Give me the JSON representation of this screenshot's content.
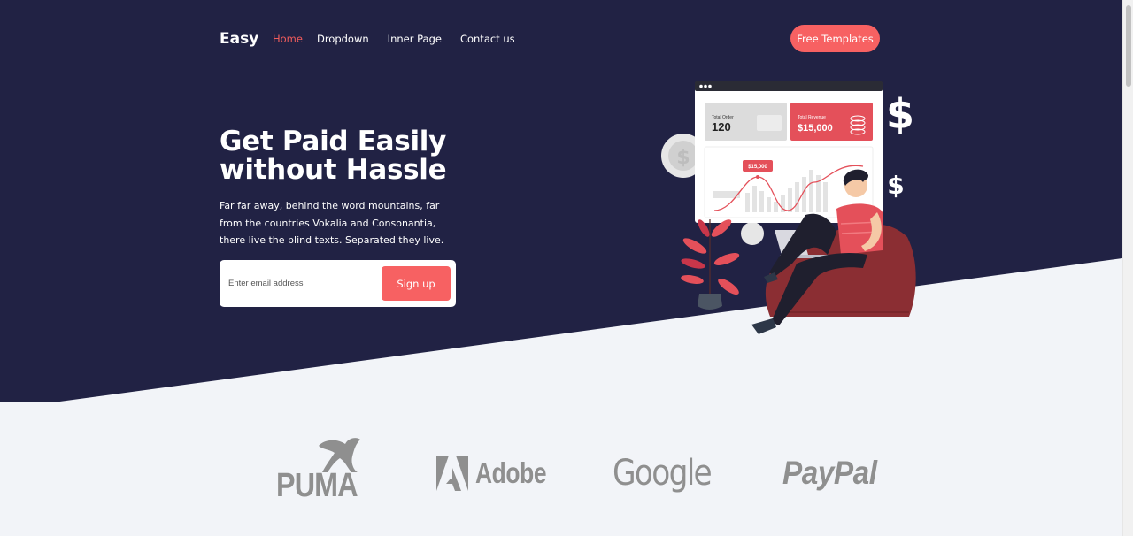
{
  "nav": {
    "logo": "Easy",
    "links": [
      "Home",
      "Dropdown",
      "Inner Page",
      "Contact us"
    ],
    "cta_label": "Free Templates"
  },
  "hero": {
    "headline_line1": "Get Paid Easily",
    "headline_line2": "without Hassle",
    "subtext": "Far far away, behind the word mountains, far from the countries Vokalia and Consonantia, there live the blind texts. Separated they live.",
    "email_placeholder": "Enter email address",
    "signup_label": "Sign up"
  },
  "illustration": {
    "total_order_label": "Total Order",
    "total_order_value": "120",
    "total_revenue_label": "Total Revenue",
    "total_revenue_value": "$15,000",
    "chart_tooltip": "$15,000",
    "dollar_symbol": "$"
  },
  "brands": [
    "PUMA",
    "Adobe",
    "Google",
    "PayPal"
  ],
  "colors": {
    "hero_bg": "#212244",
    "accent": "#f76162",
    "page_bg": "#f2f4f8",
    "brand_gray": "#8f8f8f"
  }
}
